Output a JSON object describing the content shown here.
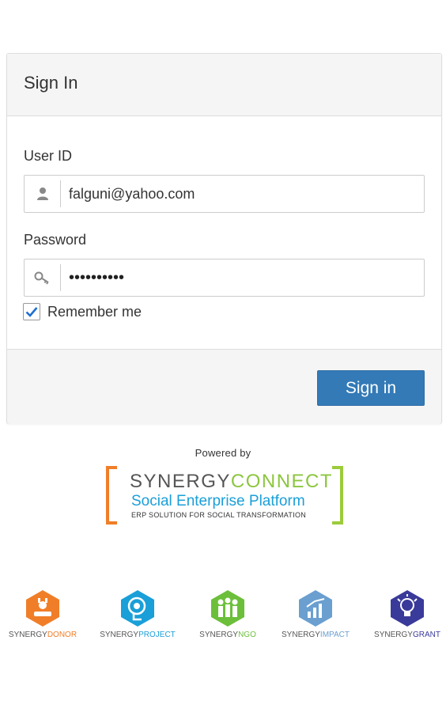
{
  "card": {
    "title": "Sign In",
    "user_label": "User ID",
    "user_value": "falguni@yahoo.com",
    "password_label": "Password",
    "password_mask": "••••••••••",
    "remember_label": "Remember me",
    "remember_checked": true,
    "signin_button": "Sign in"
  },
  "footer": {
    "powered_by": "Powered by",
    "brand": {
      "word1": "SYNERGY",
      "word2": "CONNECT",
      "tagline": "Social Enterprise Platform",
      "subtagline": "ERP SOLUTION FOR SOCIAL TRANSFORMATION"
    },
    "products": [
      {
        "prefix": "SYNERGY",
        "suffix": "DONOR",
        "color": "#f07e28"
      },
      {
        "prefix": "SYNERGY",
        "suffix": "PROJECT",
        "color": "#1a9fd8"
      },
      {
        "prefix": "SYNERGY",
        "suffix": "NGO",
        "color": "#6cbf3a"
      },
      {
        "prefix": "SYNERGY",
        "suffix": "IMPACT",
        "color": "#6a9fd0"
      },
      {
        "prefix": "SYNERGY",
        "suffix": "GRANT",
        "color": "#3a3a9a"
      }
    ]
  },
  "colors": {
    "primary": "#337ab7",
    "panel_bg": "#f5f5f5",
    "border": "#dddddd"
  }
}
